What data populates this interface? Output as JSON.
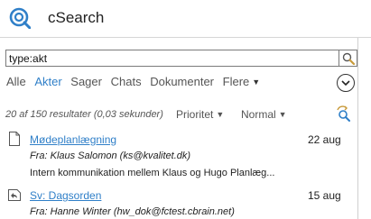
{
  "app": {
    "title": "cSearch"
  },
  "search": {
    "value": "type:akt"
  },
  "tabs": [
    {
      "label": "Alle"
    },
    {
      "label": "Akter"
    },
    {
      "label": "Sager"
    },
    {
      "label": "Chats"
    },
    {
      "label": "Dokumenter"
    },
    {
      "label": "Flere"
    }
  ],
  "results": {
    "info": "20 af 150 resultater (0,03 sekunder)",
    "sort_field": "Prioritet",
    "sort_mode": "Normal"
  },
  "items": [
    {
      "title": "Mødeplanlægning",
      "date": "22 aug",
      "from": "Fra: Klaus Salomon (ks@kvalitet.dk)",
      "snippet": "Intern kommunikation mellem Klaus og Hugo   Planlæg..."
    },
    {
      "title": "Sv: Dagsorden",
      "date": "15 aug",
      "from": "Fra: Hanne Winter (hw_dok@fctest.cbrain.net)"
    }
  ],
  "colors": {
    "accent": "#2f7fc8",
    "text": "#222222",
    "muted": "#555555"
  },
  "icons": {
    "logo": "csearch-logo-icon",
    "search": "search-icon",
    "expand": "chevron-down-circle-icon",
    "refresh": "refresh-search-icon",
    "document": "document-icon",
    "reply": "reply-document-icon"
  }
}
